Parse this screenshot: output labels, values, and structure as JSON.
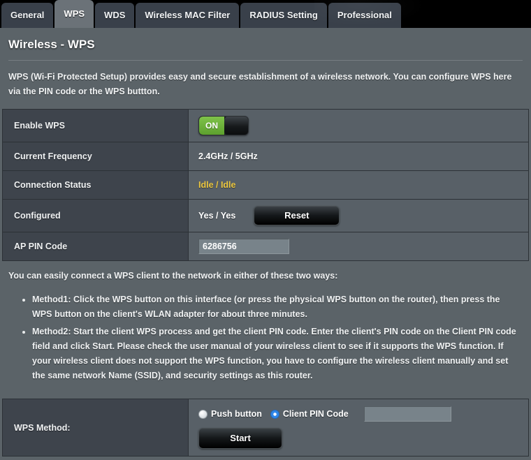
{
  "tabs": [
    {
      "label": "General",
      "active": false
    },
    {
      "label": "WPS",
      "active": true
    },
    {
      "label": "WDS",
      "active": false
    },
    {
      "label": "Wireless MAC Filter",
      "active": false
    },
    {
      "label": "RADIUS Setting",
      "active": false
    },
    {
      "label": "Professional",
      "active": false
    }
  ],
  "page": {
    "title": "Wireless - WPS",
    "intro": "WPS (Wi-Fi Protected Setup) provides easy and secure establishment of a wireless network. You can configure WPS here via the PIN code or the WPS buttton."
  },
  "settings": {
    "enable_wps": {
      "label": "Enable WPS",
      "toggle_state": "ON"
    },
    "current_frequency": {
      "label": "Current Frequency",
      "value": "2.4GHz / 5GHz"
    },
    "connection_status": {
      "label": "Connection Status",
      "value": "Idle / Idle",
      "color": "#ebc63f"
    },
    "configured": {
      "label": "Configured",
      "value": "Yes / Yes",
      "reset_button": "Reset"
    },
    "ap_pin_code": {
      "label": "AP PIN Code",
      "value": "6286756",
      "placeholder": ""
    }
  },
  "methods": {
    "intro": "You can easily connect a WPS client to the network in either of these two ways:",
    "items": [
      "Method1: Click the WPS button on this interface (or press the physical WPS button on the router), then press the WPS button on the client's WLAN adapter for about three minutes.",
      "Method2: Start the client WPS process and get the client PIN code. Enter the client's PIN code on the Client PIN code field and click Start. Please check the user manual of your wireless client to see if it supports the WPS function. If your wireless client does not support the WPS function, you have to configure the wireless client manually and set the same network Name (SSID), and security settings as this router."
    ]
  },
  "wps_method": {
    "label": "WPS Method:",
    "options": [
      {
        "label": "Push button",
        "selected": false
      },
      {
        "label": "Client PIN Code",
        "selected": true
      }
    ],
    "client_pin_value": "",
    "client_pin_placeholder": "",
    "start_button": "Start"
  },
  "colors": {
    "accent_green": "#6cb33f",
    "status_yellow": "#ebc63f",
    "radio_blue": "#2f86e8",
    "panel_bg": "#5b6368",
    "label_bg": "#3e444c",
    "value_bg": "#586067"
  }
}
